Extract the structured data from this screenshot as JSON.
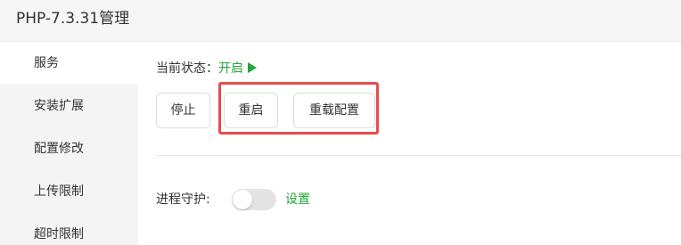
{
  "window": {
    "title": "PHP-7.3.31管理"
  },
  "sidebar": {
    "items": [
      {
        "label": "服务",
        "active": true
      },
      {
        "label": "安装扩展",
        "active": false
      },
      {
        "label": "配置修改",
        "active": false
      },
      {
        "label": "上传限制",
        "active": false
      },
      {
        "label": "超时限制",
        "active": false
      }
    ]
  },
  "service": {
    "status_label": "当前状态：",
    "status_value": "开启",
    "status_icon": "play-icon",
    "status_color": "#20a53a",
    "buttons": {
      "stop": "停止",
      "restart": "重启",
      "reload_config": "重载配置"
    },
    "highlight_color": "#e84b4b",
    "guard_label": "进程守护:",
    "guard_enabled": false,
    "guard_settings_link": "设置"
  }
}
